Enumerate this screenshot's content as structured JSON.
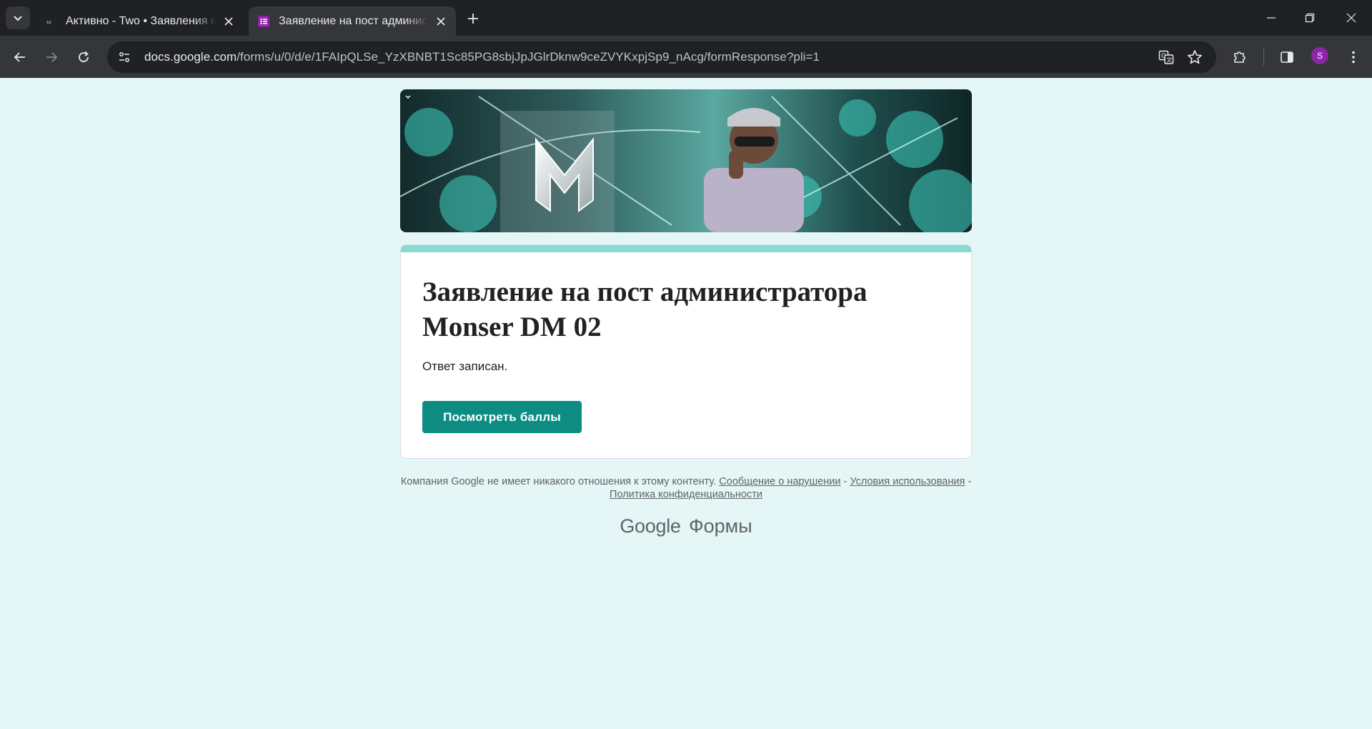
{
  "browser": {
    "tabs": [
      {
        "title": "Активно - Two • Заявления на",
        "active": false,
        "favicon": "app-icon"
      },
      {
        "title": "Заявление на пост администр",
        "active": true,
        "favicon": "google-forms-icon"
      }
    ],
    "url_host": "docs.google.com",
    "url_path": "/forms/u/0/d/e/1FAIpQLSe_YzXBNBT1Sc85PG8sbjJpJGlrDknw9ceZVYKxpjSp9_nAcg/formResponse?pli=1",
    "profile_initial": "S",
    "colors": {
      "profile": "#8e24aa",
      "forms_favicon": "#8e24aa"
    }
  },
  "form": {
    "title": "Заявление на пост администратора Monser DM 02",
    "response_message": "Ответ записан.",
    "score_button": "Посмотреть баллы",
    "colors": {
      "accent_bar": "#86dbd3",
      "button": "#0c8c83",
      "page_bg": "#e4f6f5"
    }
  },
  "footer": {
    "disclaimer": "Компания Google не имеет никакого отношения к этому контенту.",
    "report_link": "Сообщение о нарушении",
    "sep1": "-",
    "terms_link": "Условия использования",
    "sep2": "-",
    "privacy_link": "Политика конфиденциальности"
  },
  "branding": {
    "google": "Google",
    "product": "Формы"
  }
}
